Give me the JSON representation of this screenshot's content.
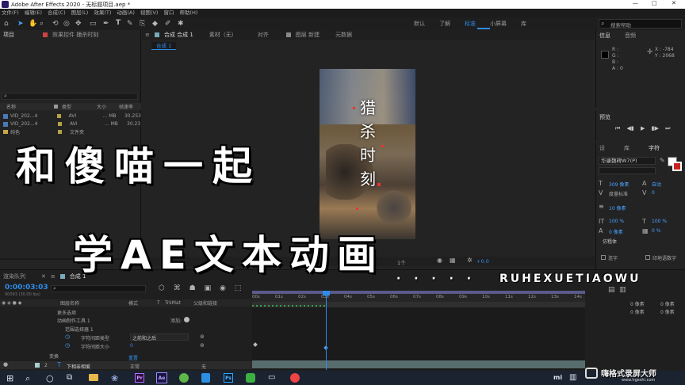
{
  "titlebar": {
    "title": "Adobe After Effects 2020 - 无标题项目.aep *",
    "controls": [
      "—",
      "□",
      "✕"
    ]
  },
  "menu": [
    "文件(F)",
    "编辑(E)",
    "合成(C)",
    "图层(L)",
    "效果(T)",
    "动画(A)",
    "视图(V)",
    "窗口",
    "帮助(H)"
  ],
  "workspaces": [
    "默认",
    "了解",
    "标准",
    "小屏幕",
    "库"
  ],
  "search_placeholder": "搜索帮助",
  "project": {
    "tab": "项目",
    "effect_tab": "效果控件 播杀时刻",
    "columns": [
      "名称",
      "类型",
      "大小",
      "帧速率"
    ],
    "items": [
      {
        "name": "VID_202...4",
        "type": "AVI",
        "size": "... MB",
        "fps": "30.253"
      },
      {
        "name": "VID_202...4",
        "type": "AVI",
        "size": "... MB",
        "fps": "30.23"
      },
      {
        "name": "纯色",
        "type": "文件夹",
        "size": "",
        "fps": ""
      }
    ],
    "bpc": "8 bpc"
  },
  "composition": {
    "tab": "合成 合成 1",
    "sub_tab": "合成 1",
    "footage_tab": "素材（无）",
    "align_tab": "对齐",
    "layer_tab": "图层 新建",
    "meta_tab": "元数据",
    "vertical_text": [
      "猎",
      "杀",
      "时",
      "刻"
    ],
    "render_label": "1个",
    "exposure": "+0.0"
  },
  "info": {
    "tab": "信息",
    "audio_tab": "音频",
    "r": "R :",
    "g": "G :",
    "b": "B :",
    "a": "A : 0",
    "x": "X : -784",
    "y": "Y : 2068"
  },
  "preview": {
    "tab": "预览"
  },
  "character": {
    "tabs": [
      "设",
      "库",
      "字符"
    ],
    "font": "华康魏碑W7(P)",
    "size": "309 像素",
    "leading": "自动",
    "kerning": "度量标准",
    "tracking": "0",
    "stroke": "10 像素",
    "v_scale": "100 %",
    "h_scale": "100 %",
    "baseline": "0 像素",
    "tsume": "0 %",
    "faux_bold": "仿粗体",
    "ligatures": "连字",
    "hindi": "印地语数字"
  },
  "timeline": {
    "render_queue_tab": "渲染队列",
    "comp_tab": "合成 1",
    "timecode": "0:00:03:03",
    "timecode_sub": "00093 (30.00 fps)",
    "columns": [
      "图层名称",
      "模式",
      "T",
      "TrkMat",
      "父级和链接"
    ],
    "rows": [
      {
        "label": "更多选项",
        "indent": 1
      },
      {
        "label": "动画制作工具 1",
        "indent": 1,
        "extra": "添加:"
      },
      {
        "label": "范围选择器 1",
        "indent": 2
      },
      {
        "label": "字符间距类型",
        "indent": 2,
        "value": "之前和之后"
      },
      {
        "label": "字符间距大小",
        "indent": 2,
        "value": "0"
      },
      {
        "label": "变换",
        "indent": 1,
        "extra": "重置"
      },
      {
        "label": "下相亲相爱",
        "indent": 0,
        "number": "2",
        "mode": "正常",
        "parent": "无"
      }
    ],
    "ruler": [
      "00s",
      "01s",
      "02s",
      "03s",
      "04s",
      "05s",
      "06s",
      "07s",
      "08s",
      "09s",
      "10s",
      "11s",
      "12s",
      "13s",
      "14s"
    ],
    "toggle_label": "切换开关/模式"
  },
  "overlay": {
    "line1": "和傻喵一起",
    "line2": "学AE文本动画",
    "dots": "· · · · ·",
    "url": "RUHEXUETIAOWU",
    "watermark": "嗨格式录屏大师",
    "watermark_url": "www.hgeshi.com"
  },
  "taskbar": {
    "icons": [
      "windows-icon",
      "search-icon",
      "task-view-icon",
      "explorer-icon",
      "store-icon",
      "premiere-icon",
      "aftereffects-icon",
      "browser-icon",
      "photoshop-icon",
      "wechat-icon",
      "app-icon"
    ],
    "labels": {
      "pr": "Pr",
      "ae": "Ae",
      "ps": "Ps",
      "mi": "mi"
    }
  },
  "colors": {
    "accent": "#2d8ceb",
    "panel": "#232323",
    "keyframe": "#4b9fe6",
    "work_area": "#5a5a8a"
  }
}
